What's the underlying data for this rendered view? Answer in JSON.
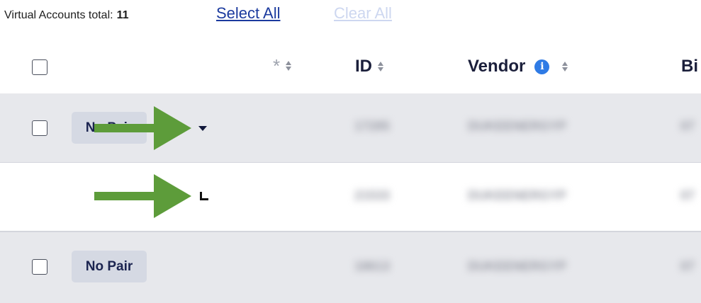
{
  "summary": {
    "label": "Virtual Accounts total:",
    "count": "11"
  },
  "actions": {
    "select_all": "Select All",
    "clear_all": "Clear All"
  },
  "table": {
    "columns": {
      "star": "*",
      "id": "ID",
      "vendor": "Vendor",
      "vendor_info": "i",
      "next": "Bi"
    },
    "rows": [
      {
        "pill": "No Pair",
        "id": "17285",
        "vendor": "DUKEENERGYP",
        "extra": "07"
      },
      {
        "pill": "",
        "id": "21533",
        "vendor": "DUKEENERGYP",
        "extra": "07"
      },
      {
        "pill": "No Pair",
        "id": "18613",
        "vendor": "DUKEENERGYP",
        "extra": "07"
      }
    ]
  },
  "colors": {
    "link": "#1b3a9e",
    "link_disabled": "#cdd7f0",
    "info_icon": "#2f7be5",
    "row_shaded": "#e7e8ec",
    "pill": "#d5d9e3",
    "annotation_arrow": "#5d9c3a"
  }
}
